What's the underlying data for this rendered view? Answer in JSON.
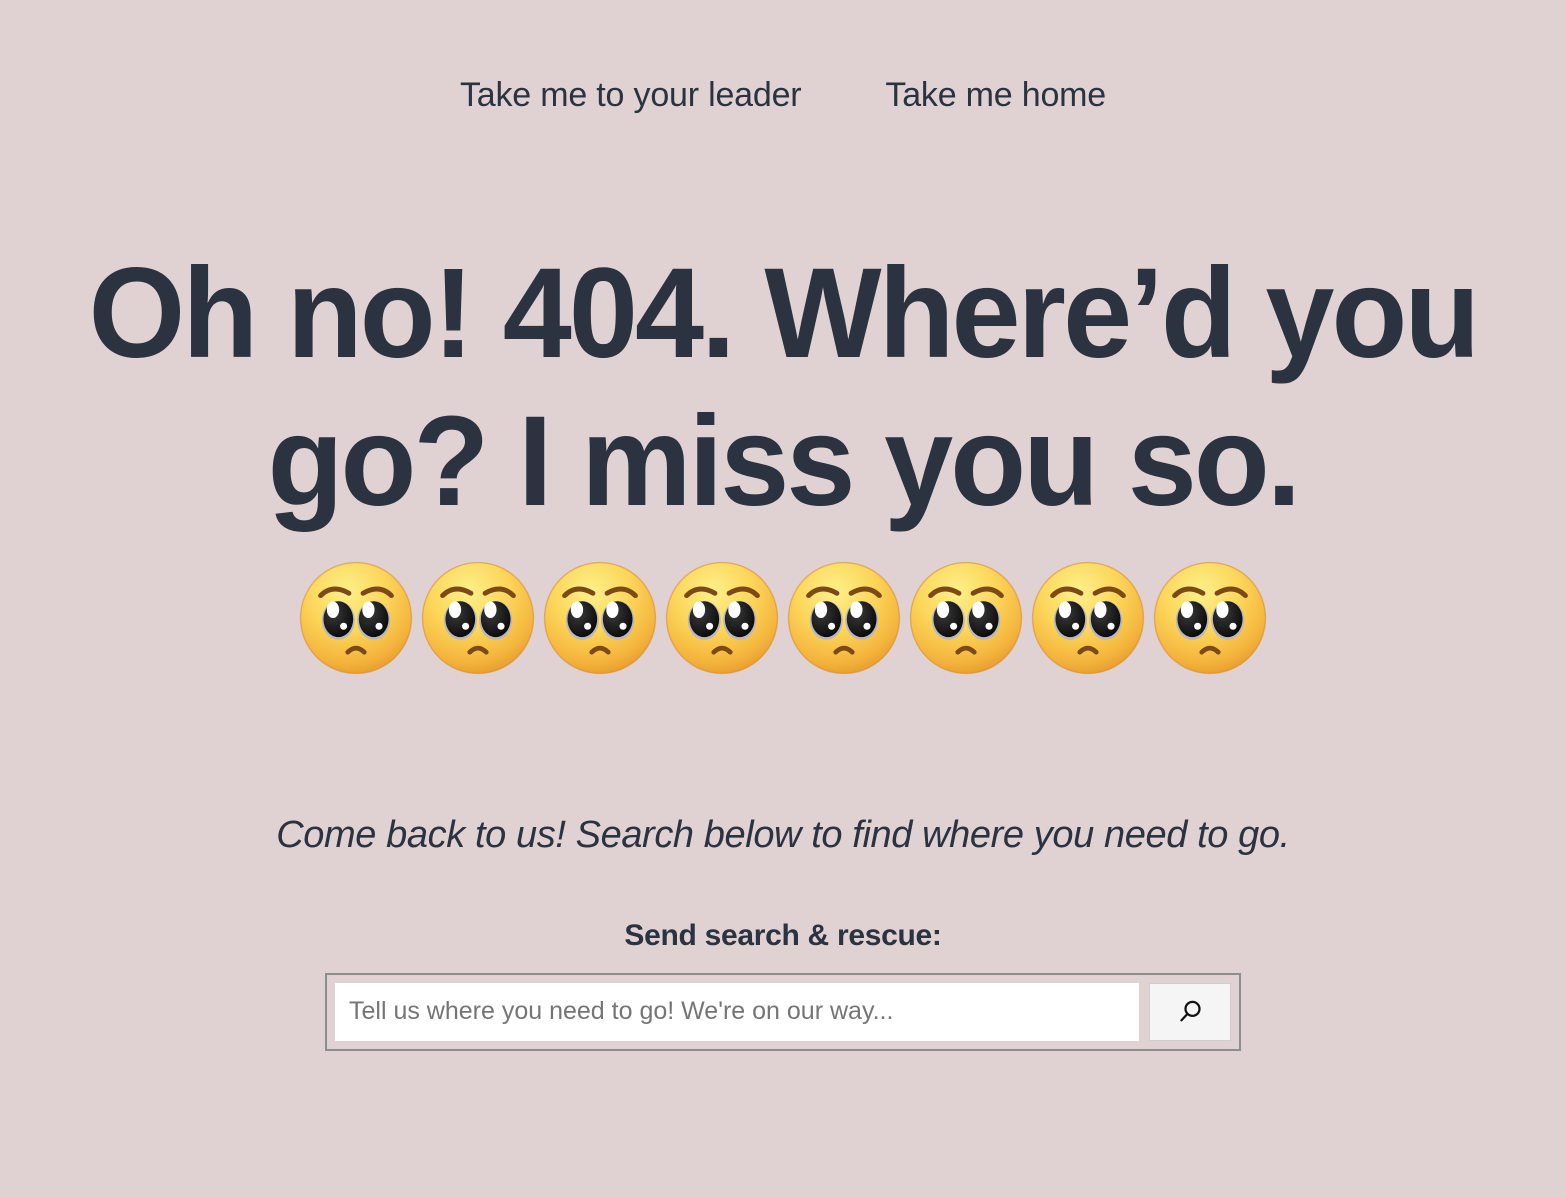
{
  "theme": {
    "background_color": "#e0d2d2",
    "text_color": "#2b3240",
    "input_background": "#ffffff",
    "button_background": "#f5f5f5",
    "border_color": "#8d8d8d",
    "placeholder_color": "#757575"
  },
  "nav": {
    "links": [
      {
        "label": "Take me to your leader"
      },
      {
        "label": "Take me home"
      }
    ]
  },
  "hero": {
    "headline": "Oh no! 404. Where’d you go? I miss you so.",
    "emoji": {
      "name": "pleading-face",
      "glyph": "🥺",
      "count": 8
    },
    "subtitle": "Come back to us! Search below to find where you need to go."
  },
  "search": {
    "label": "Send search & rescue:",
    "placeholder": "Tell us where you need to go! We're on our way...",
    "value": "",
    "button_icon": "search-icon"
  }
}
